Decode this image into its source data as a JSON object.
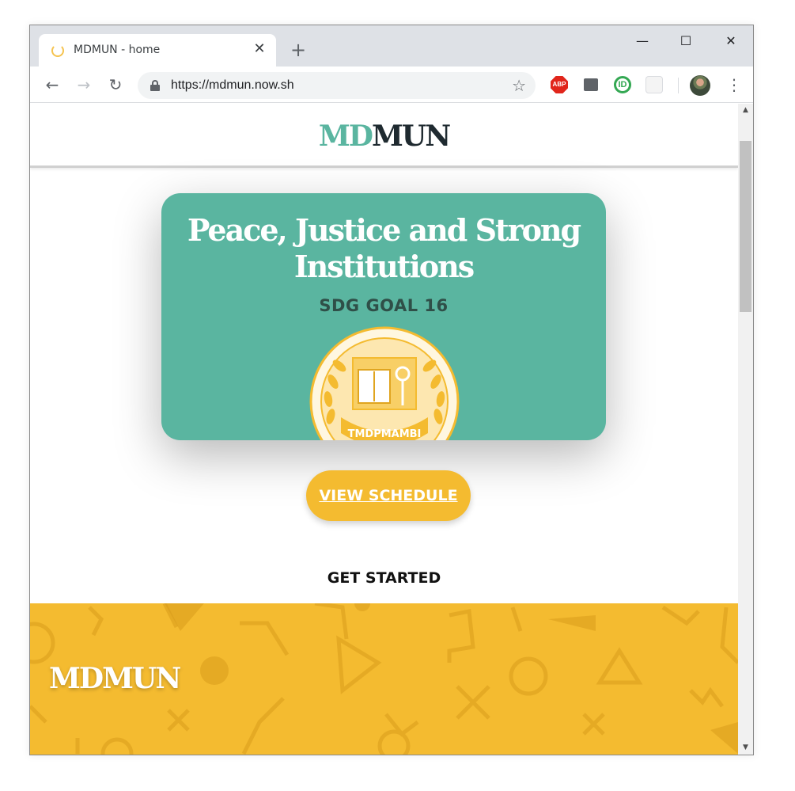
{
  "browser": {
    "tab_title": "MDMUN - home",
    "tab_close_glyph": "✕",
    "new_tab_glyph": "+",
    "url": "https://mdmun.now.sh",
    "window_controls": {
      "minimize": "—",
      "maximize": "☐",
      "close": "✕"
    },
    "nav": {
      "back": "←",
      "forward": "→",
      "reload": "↻"
    },
    "star_glyph": "☆",
    "menu_glyph": "⋮",
    "extensions": {
      "abp_label": "ABP",
      "id_label": "ID"
    }
  },
  "site": {
    "logo_part1": "MD",
    "logo_part2": "MUN",
    "hero": {
      "title": "Peace, Justice and Strong Institutions",
      "subtitle": "SDG GOAL 16",
      "emblem_text": "TMDPMAMBI"
    },
    "schedule_button": "VIEW SCHEDULE",
    "get_started": "GET STARTED",
    "footer_logo": "MDMUN"
  },
  "colors": {
    "accent_teal": "#5ab5a0",
    "accent_yellow": "#f4bb30",
    "logo_dark": "#1f2a30"
  }
}
